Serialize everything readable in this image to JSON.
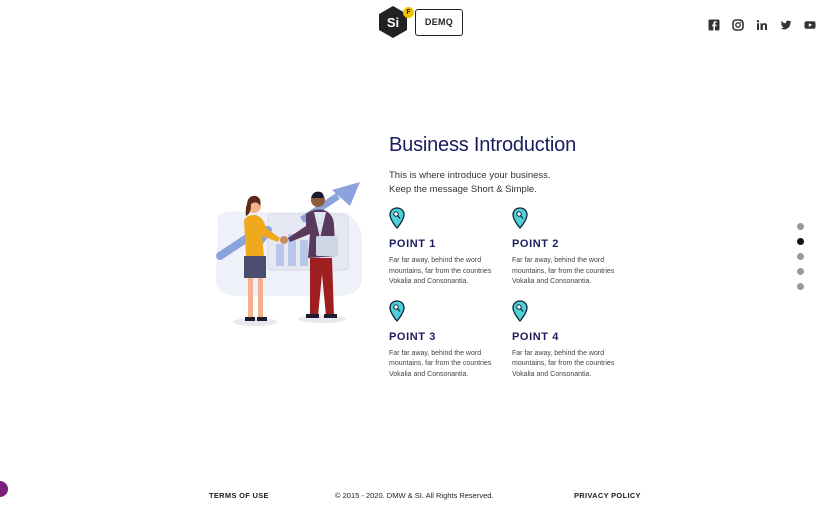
{
  "header": {
    "logo_text": "Si",
    "logo_badge": "F",
    "demo_label": "DEMQ"
  },
  "social": [
    {
      "icon": "facebook-icon"
    },
    {
      "icon": "instagram-icon"
    },
    {
      "icon": "linkedin-icon"
    },
    {
      "icon": "twitter-icon"
    },
    {
      "icon": "youtube-icon"
    }
  ],
  "main": {
    "title": "Business Introduction",
    "desc_line1": "This is where introduce your business.",
    "desc_line2": "Keep the message Short & Simple.",
    "points": [
      {
        "title": "POINT 1",
        "text": "Far far away, behind the word mountains, far from the countries Vokalia and Consonantia."
      },
      {
        "title": "POINT 2",
        "text": "Far far away, behind the word mountains, far from the countries Vokalia and Consonantia."
      },
      {
        "title": "POINT 3",
        "text": "Far far away, behind the word mountains, far from the countries Vokalia and Consonantia."
      },
      {
        "title": "POINT 4",
        "text": "Far far away, behind the word mountains, far from the countries Vokalia and Consonantia."
      }
    ]
  },
  "nav_dots": {
    "count": 5,
    "active_index": 1
  },
  "footer": {
    "terms": "TERMS OF USE",
    "copyright": "© 2015 - 2020. DMW & SI. All Rights Reserved.",
    "privacy": "PRIVACY POLICY"
  },
  "colors": {
    "title": "#1b1b5e",
    "pin": "#4dd0d8",
    "chat": "#7a1f7a"
  }
}
